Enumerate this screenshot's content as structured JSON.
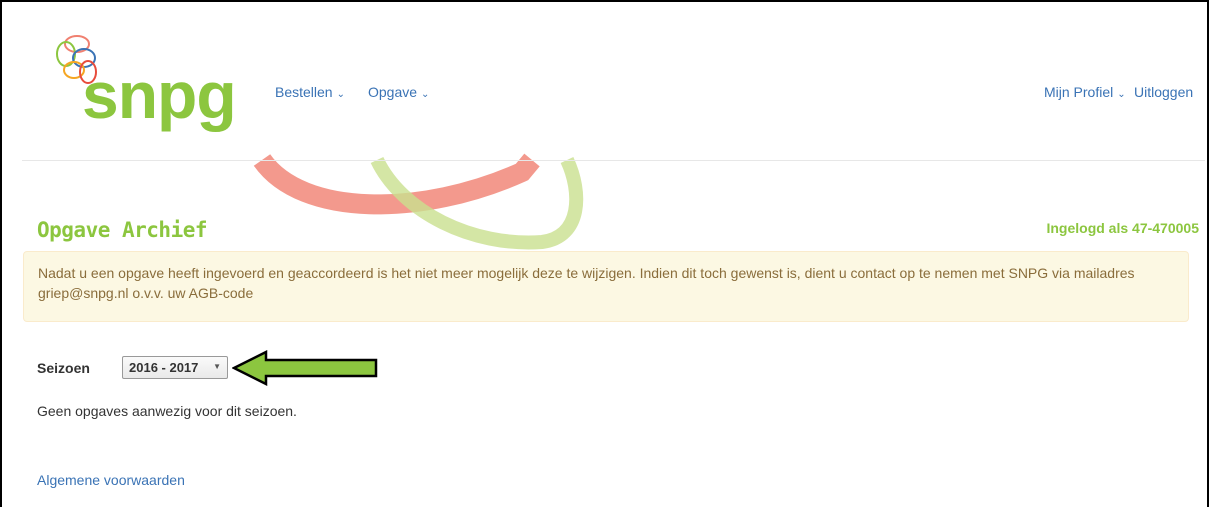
{
  "header": {
    "logo_text": "snpg",
    "nav_left": [
      {
        "label": "Bestellen",
        "chevron": "⌄"
      },
      {
        "label": "Opgave",
        "chevron": "⌄"
      }
    ],
    "profile": {
      "label": "Mijn Profiel",
      "chevron": "⌄"
    },
    "logout": "Uitloggen"
  },
  "page": {
    "title": "Opgave Archief",
    "logged_in": "Ingelogd als 47-470005",
    "alert": "Nadat u een opgave heeft ingevoerd en geaccordeerd is het niet meer mogelijk deze te wijzigen. Indien dit toch gewenst is, dient u contact op te nemen met SNPG via mailadres griep@snpg.nl o.v.v. uw AGB-code",
    "season_label": "Seizoen",
    "season_value": "2016 - 2017",
    "empty_message": "Geen opgaves aanwezig voor dit seizoen."
  },
  "footer": {
    "terms_link": "Algemene voorwaarden"
  },
  "colors": {
    "brand_green": "#8cc63f",
    "link_blue": "#3a73b5",
    "deco_red": "#f08070",
    "alert_bg": "#fcf8e3",
    "arrow_fill": "#8cc63f"
  }
}
